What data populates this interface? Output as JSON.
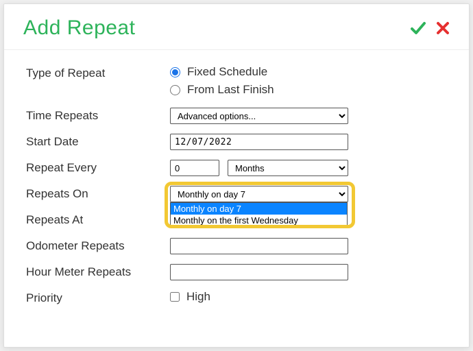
{
  "header": {
    "title": "Add Repeat"
  },
  "form": {
    "typeOfRepeat": {
      "label": "Type of Repeat",
      "option1": "Fixed Schedule",
      "option2": "From Last Finish",
      "selected": "fixed"
    },
    "timeRepeats": {
      "label": "Time Repeats",
      "value": "Advanced options..."
    },
    "startDate": {
      "label": "Start Date",
      "value": "12/07/2022"
    },
    "repeatEvery": {
      "label": "Repeat Every",
      "num": "0",
      "unit": "Months"
    },
    "repeatsOn": {
      "label": "Repeats On",
      "selected": "Monthly on day 7",
      "options": {
        "opt1": "Monthly on day 7",
        "opt2": "Monthly on the first Wednesday"
      }
    },
    "repeatsAt": {
      "label": "Repeats At"
    },
    "odometerRepeats": {
      "label": "Odometer Repeats",
      "value": ""
    },
    "hourMeterRepeats": {
      "label": "Hour Meter Repeats",
      "value": ""
    },
    "priority": {
      "label": "Priority",
      "checkboxLabel": "High"
    }
  }
}
